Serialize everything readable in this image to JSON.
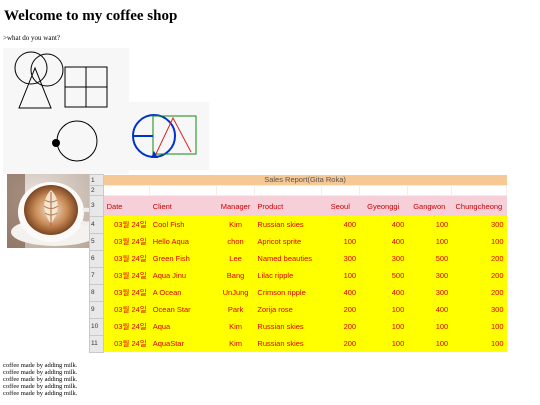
{
  "page": {
    "title": "Welcome to my coffee shop",
    "subtitle": ">what do you want?"
  },
  "sheet": {
    "report_title": "Sales Report(Gita Roka)",
    "row_numbers": [
      "1",
      "2",
      "3",
      "4",
      "5",
      "6",
      "7",
      "8",
      "9",
      "10",
      "11"
    ],
    "columns": [
      "Date",
      "Client",
      "Manager",
      "Product",
      "Seoul",
      "Gyeonggi",
      "Gangwon",
      "Chungcheong"
    ],
    "rows": [
      [
        "03월 24일",
        "Cool Fish",
        "Kim",
        "Russian skies",
        "400",
        "400",
        "100",
        "300"
      ],
      [
        "03월 24일",
        "Hello Aqua",
        "chon",
        "Apricot sprite",
        "100",
        "400",
        "100",
        "100"
      ],
      [
        "03월 24일",
        "Green Fish",
        "Lee",
        "Named beauties",
        "300",
        "300",
        "500",
        "200"
      ],
      [
        "03월 24일",
        "Aqua Jinu",
        "Bang",
        "Lilac ripple",
        "100",
        "500",
        "300",
        "200"
      ],
      [
        "03월 24일",
        "A Ocean",
        "UnJung",
        "Crimson ripple",
        "400",
        "400",
        "300",
        "200"
      ],
      [
        "03월 24일",
        "Ocean Star",
        "Park",
        "Zorija rose",
        "200",
        "100",
        "400",
        "300"
      ],
      [
        "03월 24일",
        "Aqua",
        "Kim",
        "Russian skies",
        "200",
        "100",
        "100",
        "100"
      ],
      [
        "03월 24일",
        "AquaStar",
        "Kim",
        "Russian skies",
        "200",
        "100",
        "100",
        "100"
      ]
    ]
  },
  "footer_lines": [
    "coffee made by adding milk.",
    "coffee made by adding milk.",
    "coffee made by adding milk.",
    "coffee made by adding milk.",
    "coffee made by adding milk."
  ],
  "colors": {
    "report_header": "#f6c894",
    "column_header": "#f6cfd8",
    "data_fill": "#ffff00",
    "data_text": "#dd0000"
  }
}
